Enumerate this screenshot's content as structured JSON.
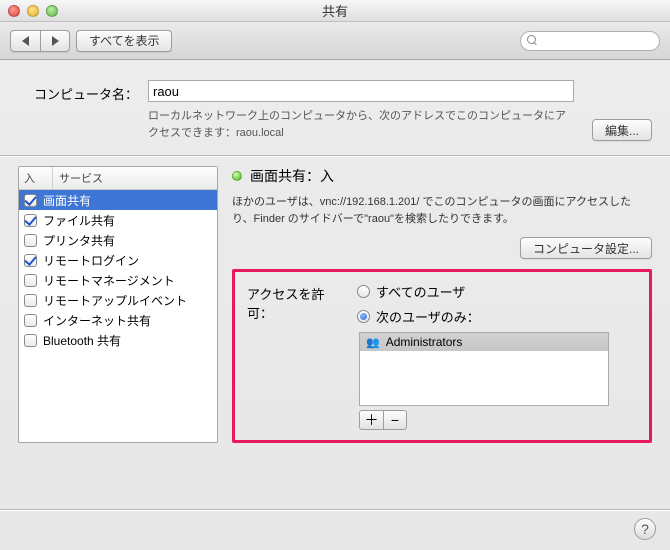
{
  "window": {
    "title": "共有"
  },
  "toolbar": {
    "show_all": "すべてを表示",
    "search_placeholder": ""
  },
  "computer_name": {
    "label": "コンピュータ名：",
    "value": "raou",
    "desc_prefix": "ローカルネットワーク上のコンピュータから、次のアドレスでこのコンピュータにアクセスできます：",
    "local_name": "raou.local",
    "edit": "編集..."
  },
  "list": {
    "header_on": "入",
    "header_service": "サービス",
    "items": [
      {
        "on": true,
        "name": "画面共有",
        "selected": true
      },
      {
        "on": true,
        "name": "ファイル共有"
      },
      {
        "on": false,
        "name": "プリンタ共有"
      },
      {
        "on": true,
        "name": "リモートログイン"
      },
      {
        "on": false,
        "name": "リモートマネージメント"
      },
      {
        "on": false,
        "name": "リモートアップルイベント"
      },
      {
        "on": false,
        "name": "インターネット共有"
      },
      {
        "on": false,
        "name": "Bluetooth 共有"
      }
    ]
  },
  "right": {
    "status_label": "画面共有：入",
    "info": "ほかのユーザは、vnc://192.168.1.201/ でこのコンピュータの画面にアクセスしたり、Finder のサイドバーで\"raou\"を検索したりできます。",
    "computer_settings": "コンピュータ設定...",
    "access_label": "アクセスを許可：",
    "radio_all": "すべてのユーザ",
    "radio_only": "次のユーザのみ：",
    "radio_selected": "only",
    "users": [
      {
        "name": "Administrators",
        "is_group": true
      }
    ]
  }
}
